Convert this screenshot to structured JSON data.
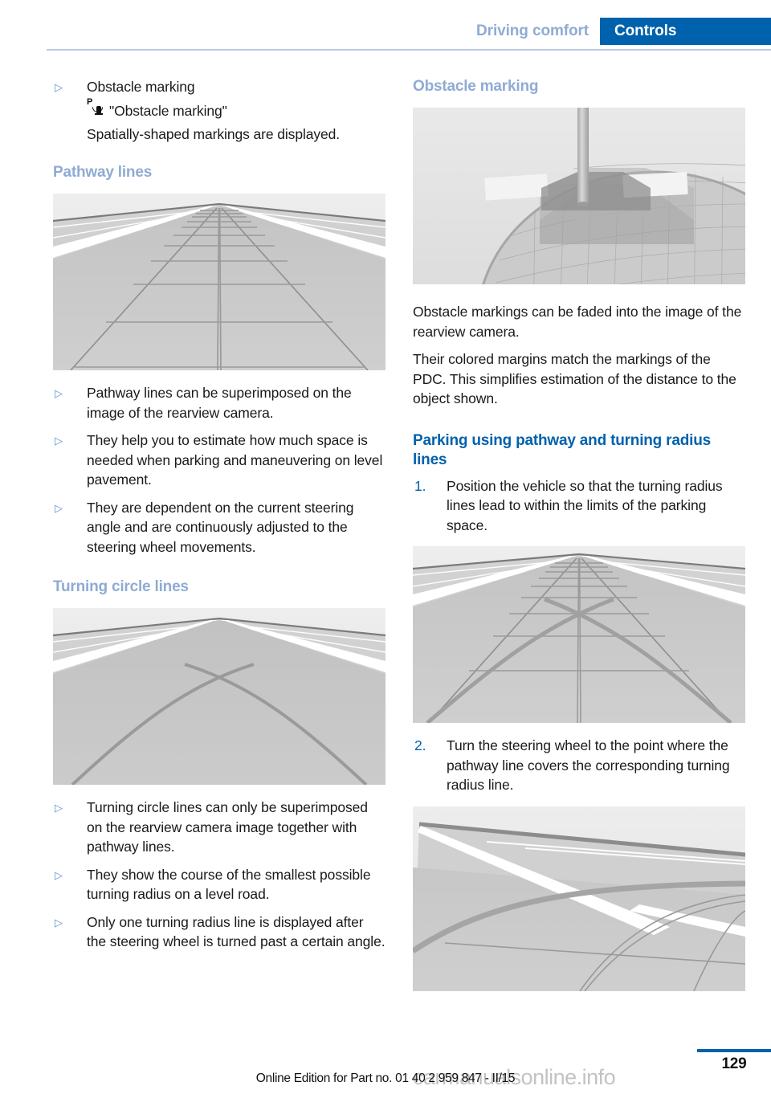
{
  "header": {
    "tab_inactive": "Driving comfort",
    "tab_active": "Controls",
    "accent_color": "#0061ad",
    "muted_blue": "#8fabd4"
  },
  "left_column": {
    "bullet_obstacle_marking": "Obstacle marking",
    "icon_name": "pdc-obstacle-marking-icon",
    "icon_caption": "\"Obstacle marking\"",
    "icon_note": "Spatially-shaped markings are displayed.",
    "heading_pathway": "Pathway lines",
    "figure_pathway_name": "pathway-lines-figure",
    "bullets_pathway": [
      "Pathway lines can be superimposed on the image of the rearview camera.",
      "They help you to estimate how much space is needed when parking and maneuvering on level pavement.",
      "They are dependent on the current steering angle and are continuously adjusted to the steering wheel movements."
    ],
    "heading_turning": "Turning circle lines",
    "figure_turning_name": "turning-circle-lines-figure",
    "bullets_turning": [
      "Turning circle lines can only be superimposed on the rearview camera image together with pathway lines.",
      "They show the course of the smallest possible turning radius on a level road.",
      "Only one turning radius line is displayed after the steering wheel is turned past a certain angle."
    ]
  },
  "right_column": {
    "heading_obstacle": "Obstacle marking",
    "figure_obstacle_name": "obstacle-marking-figure",
    "paragraphs_obstacle": [
      "Obstacle markings can be faded into the image of the rearview camera.",
      "Their colored margins match the markings of the PDC. This simplifies estimation of the distance to the object shown."
    ],
    "heading_parking": "Parking using pathway and turning radius lines",
    "steps": [
      {
        "number": "1.",
        "text": "Position the vehicle so that the turning radius lines lead to within the limits of the parking space."
      },
      {
        "number": "2.",
        "text": "Turn the steering wheel to the point where the pathway line covers the corresponding turning radius line."
      }
    ],
    "figure_step1_name": "parking-step1-figure",
    "figure_step2_name": "parking-step2-figure"
  },
  "footer": {
    "page_number": "129",
    "edition_text": "Online Edition for Part no. 01 40 2 959 847 - II/15",
    "watermark": "carmanualsonline.info"
  }
}
